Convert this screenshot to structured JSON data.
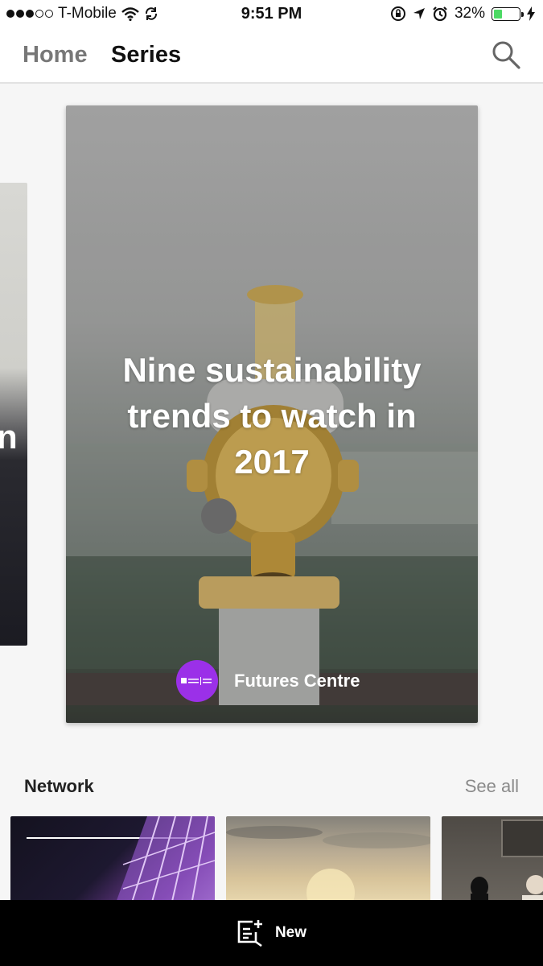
{
  "status_bar": {
    "carrier": "T-Mobile",
    "time": "9:51 PM",
    "battery": "32%",
    "battery_level": 0.32
  },
  "header": {
    "tabs": [
      {
        "label": "Home"
      },
      {
        "label": "Series"
      }
    ],
    "active_tab": "Series"
  },
  "featured": {
    "title": "Nine sustainability trends to watch in 2017",
    "author": "Futures Centre",
    "side_card_partial_text": "n"
  },
  "network": {
    "title": "Network",
    "see_all": "See all"
  },
  "bottom_bar": {
    "new_label": "New"
  },
  "colors": {
    "author_avatar": "#9b30e8",
    "battery_fill": "#4cd964"
  }
}
